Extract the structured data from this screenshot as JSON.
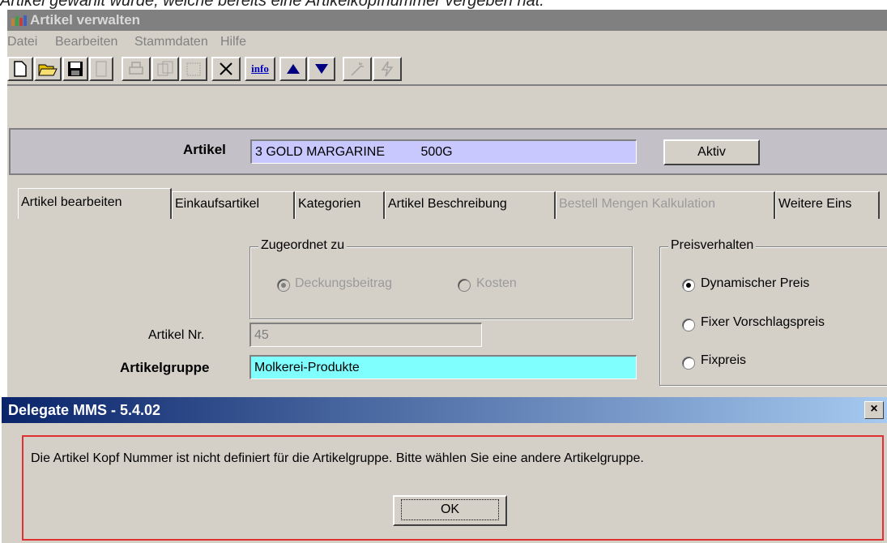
{
  "caption": "Artikel gewählt wurde, welche bereits eine Artikelkopfnummer vergeben hat.",
  "window": {
    "title": "Artikel verwalten"
  },
  "menu": [
    "Datei",
    "Bearbeiten",
    "Stammdaten",
    "Hilfe"
  ],
  "toolbar": {
    "icons": [
      "new-icon",
      "open-icon",
      "save-icon",
      "blank-icon",
      "print-icon",
      "copy-icon",
      "paste-icon",
      "delete-icon",
      "info-icon",
      "up-icon",
      "down-icon",
      "wand-icon",
      "flash-icon"
    ],
    "info_label": "info"
  },
  "header": {
    "artikel_label": "Artikel",
    "artikel_value": "3 GOLD MARGARINE          500G",
    "aktiv_label": "Aktiv"
  },
  "tabs": [
    {
      "label": "Artikel bearbeiten",
      "active": true
    },
    {
      "label": "Einkaufsartikel"
    },
    {
      "label": "Kategorien"
    },
    {
      "label": "Artikel Beschreibung"
    },
    {
      "label": "Bestell Mengen Kalkulation",
      "disabled": true
    },
    {
      "label": "Weitere Eins"
    }
  ],
  "zugeordnet": {
    "title": "Zugeordnet zu",
    "options": [
      "Deckungsbeitrag",
      "Kosten"
    ],
    "selected": "Deckungsbeitrag"
  },
  "preisverhalten": {
    "title": "Preisverhalten",
    "options": [
      "Dynamischer Preis",
      "Fixer Vorschlagspreis",
      "Fixpreis"
    ],
    "selected": "Dynamischer Preis"
  },
  "artikel_nr": {
    "label": "Artikel Nr.",
    "value": "45"
  },
  "artikelgruppe": {
    "label": "Artikelgruppe",
    "value": "Molkerei-Produkte"
  },
  "dialog": {
    "title": "Delegate MMS - 5.4.02",
    "close": "×",
    "message": "Die Artikel Kopf Nummer ist nicht definiert für die Artikelgruppe. Bitte wählen Sie eine andere Artikelgruppe.",
    "ok_label": "OK"
  },
  "colors": {
    "artikel_field": "#c8c8ff",
    "artikelgruppe_field": "#80ffff",
    "dialog_border": "#e03030"
  }
}
